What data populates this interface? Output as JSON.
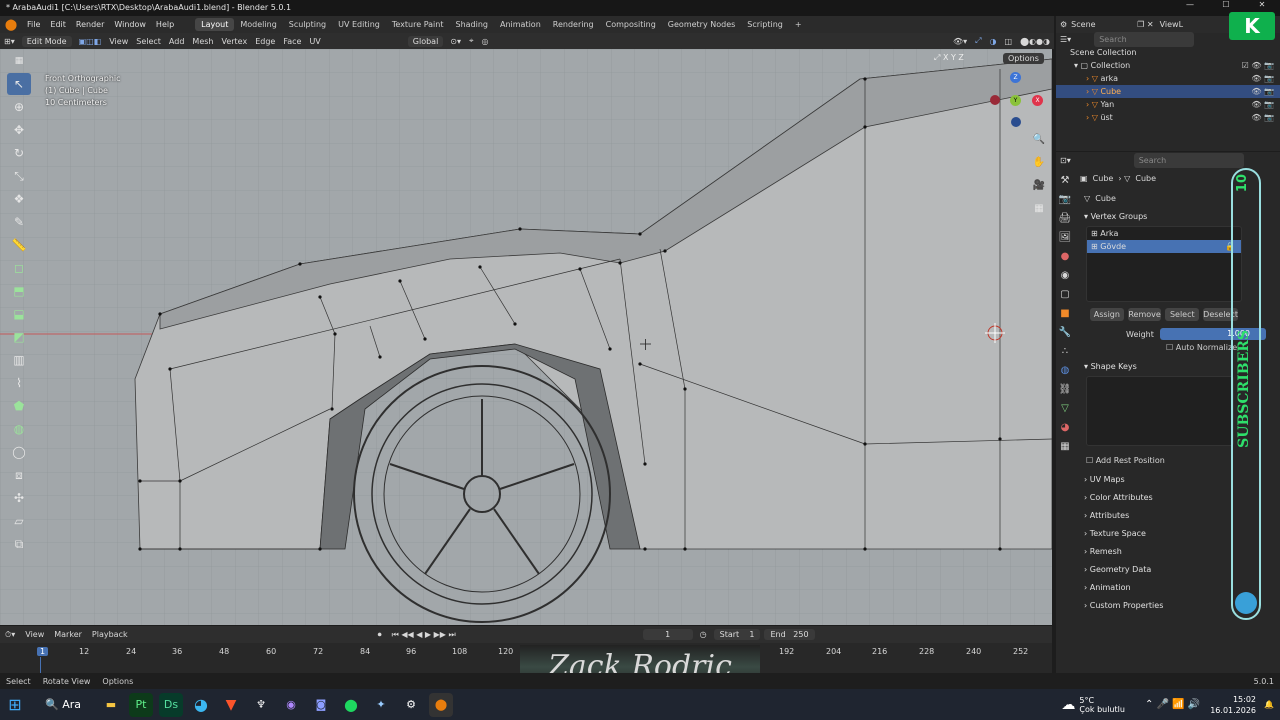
{
  "window": {
    "title": "* ArabaAudi1 [C:\\Users\\RTX\\Desktop\\ArabaAudi1.blend] - Blender 5.0.1"
  },
  "menu": [
    "File",
    "Edit",
    "Render",
    "Window",
    "Help"
  ],
  "workspaces": [
    "Layout",
    "Modeling",
    "Sculpting",
    "UV Editing",
    "Texture Paint",
    "Shading",
    "Animation",
    "Rendering",
    "Compositing",
    "Geometry Nodes",
    "Scripting"
  ],
  "active_workspace": "Layout",
  "scene": {
    "label": "Scene",
    "view_layer": "ViewL"
  },
  "viewport_header": {
    "mode": "Edit Mode",
    "items": [
      "View",
      "Select",
      "Add",
      "Mesh",
      "Vertex",
      "Edge",
      "Face",
      "UV"
    ],
    "orientation": "Global",
    "options": "Options"
  },
  "viewport_info": {
    "line1": "Front Orthographic",
    "line2": "(1) Cube | Cube",
    "line3": "10 Centimeters"
  },
  "gizmo": {
    "z": "Z",
    "y": "Y",
    "x": "X"
  },
  "timeline": {
    "items": [
      "View",
      "Marker",
      "Playback"
    ],
    "current_frame": "1",
    "start_label": "Start",
    "start": "1",
    "end_label": "End",
    "end": "250",
    "ticks": [
      "1",
      "12",
      "24",
      "36",
      "48",
      "60",
      "72",
      "84",
      "96",
      "108",
      "120",
      "192",
      "204",
      "216",
      "228",
      "240",
      "252"
    ]
  },
  "statusbar": {
    "select": "Select",
    "rotate": "Rotate View",
    "options": "Options",
    "version": "5.0.1"
  },
  "outliner": {
    "search_placeholder": "Search",
    "root": "Scene Collection",
    "collection": "Collection",
    "objects": [
      "arka",
      "Cube",
      "Yan",
      "üst"
    ],
    "selected": "Cube"
  },
  "properties": {
    "search_placeholder": "Search",
    "breadcrumb": [
      "Cube",
      "Cube"
    ],
    "mesh_name": "Cube",
    "vertex_groups": {
      "title": "Vertex Groups",
      "items": [
        "Arka",
        "Gövde"
      ],
      "active": "Gövde"
    },
    "buttons": {
      "assign": "Assign",
      "remove": "Remove",
      "select": "Select",
      "deselect": "Deselect"
    },
    "weight_label": "Weight",
    "weight_value": "1.000",
    "auto_normalize": "Auto Normalize",
    "shape_keys": "Shape Keys",
    "add_rest_position": "Add Rest Position",
    "panels": [
      "UV Maps",
      "Color Attributes",
      "Attributes",
      "Texture Space",
      "Remesh",
      "Geometry Data",
      "Animation",
      "Custom Properties"
    ]
  },
  "watermark": "Zack Rodric",
  "overlay": {
    "badge": "K",
    "subscribers": "SUBSCRIBERS",
    "count": "10"
  },
  "taskbar": {
    "search": "Ara",
    "weather_temp": "5°C",
    "weather_desc": "Çok bulutlu",
    "time": "15:02",
    "date": "16.01.2026"
  },
  "colors": {
    "accent": "#4772b3",
    "edit_orange": "#e87d0d",
    "viewport_bg": "#9aa0a3",
    "selected_row": "#334d80"
  }
}
